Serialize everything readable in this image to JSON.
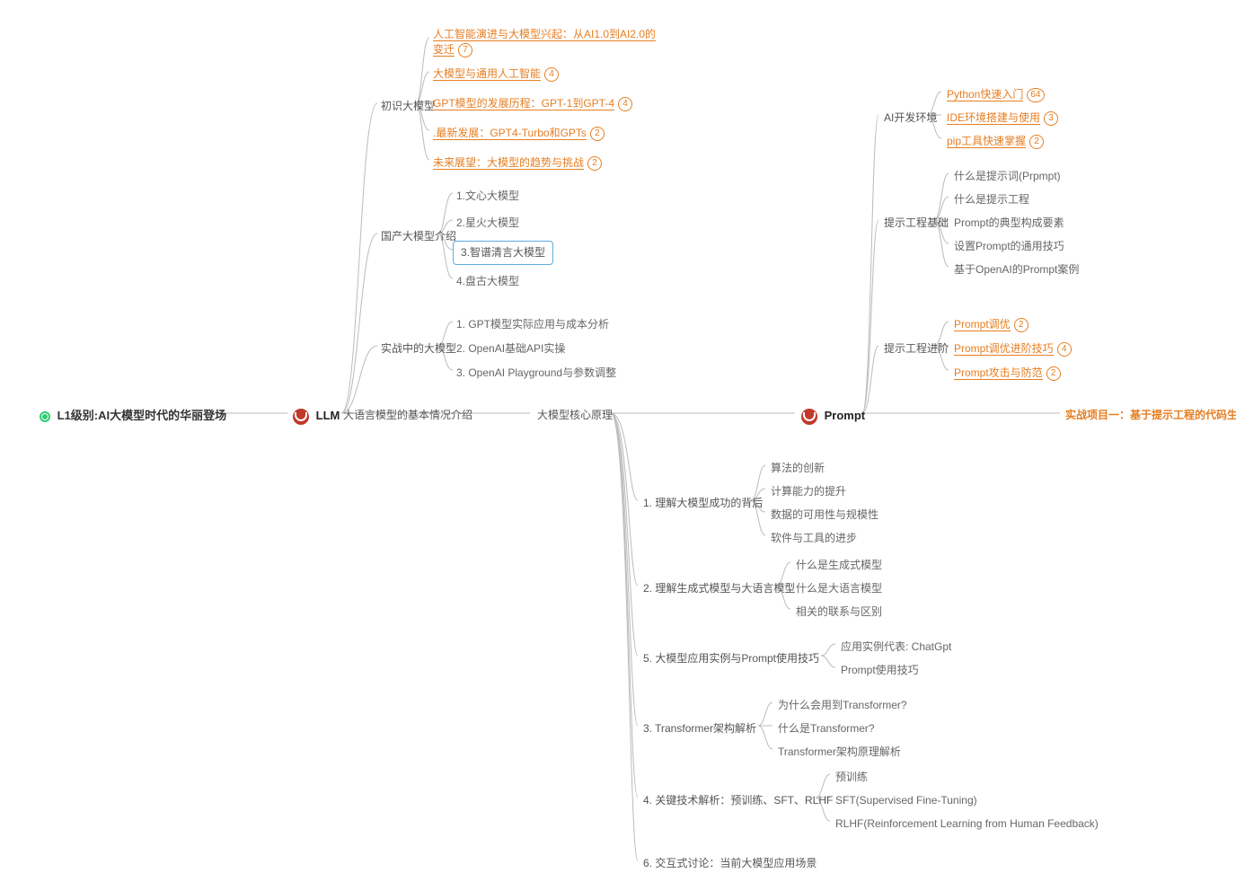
{
  "root": "L1级别:AI大模型时代的华丽登场",
  "llm": {
    "label": "LLM",
    "title": "大语言模型的基本情况介绍",
    "branch1": {
      "label": "初识大模型",
      "items": [
        {
          "text": "人工智能演进与大模型兴起：从AI1.0到AI2.0的变迁",
          "badge": "7"
        },
        {
          "text": "大模型与通用人工智能",
          "badge": "4"
        },
        {
          "text": "GPT模型的发展历程：GPT-1到GPT-4",
          "badge": "4"
        },
        {
          "text": ".最新发展：GPT4-Turbo和GPTs",
          "badge": "2"
        },
        {
          "text": "未来展望：大模型的趋势与挑战",
          "badge": "2"
        }
      ]
    },
    "branch2": {
      "label": "国产大模型介绍",
      "items": [
        {
          "text": "1.文心大模型"
        },
        {
          "text": "2.星火大模型"
        },
        {
          "text": "3.智谱清言大模型",
          "highlighted": true
        },
        {
          "text": "4.盘古大模型"
        }
      ]
    },
    "branch3": {
      "label": "实战中的大模型",
      "items": [
        {
          "text": "1. GPT模型实际应用与成本分析"
        },
        {
          "text": "2. OpenAI基础API实操"
        },
        {
          "text": "3. OpenAI Playground与参数调整"
        }
      ]
    }
  },
  "core": {
    "title": "大模型核心原理",
    "sec1": {
      "label": "1. 理解大模型成功的背后",
      "items": [
        "算法的创新",
        "计算能力的提升",
        "数据的可用性与规模性",
        "软件与工具的进步"
      ]
    },
    "sec2": {
      "label": "2. 理解生成式模型与大语言模型",
      "items": [
        "什么是生成式模型",
        "什么是大语言模型",
        "相关的联系与区别"
      ]
    },
    "sec5": {
      "label": "5. 大模型应用实例与Prompt使用技巧",
      "items": [
        "应用实例代表: ChatGpt",
        "Prompt使用技巧"
      ]
    },
    "sec3": {
      "label": "3. Transformer架构解析",
      "items": [
        "为什么会用到Transformer?",
        "什么是Transformer?",
        "Transformer架构原理解析"
      ]
    },
    "sec4": {
      "label": "4. 关键技术解析：预训练、SFT、RLHF",
      "items": [
        "预训练",
        "SFT(Supervised Fine-Tuning)",
        "RLHF(Reinforcement Learning from Human Feedback)"
      ]
    },
    "sec6": {
      "label": "6. 交互式讨论：当前大模型应用场景"
    }
  },
  "prompt": {
    "label": "Prompt",
    "env": {
      "label": "AI开发环境",
      "items": [
        {
          "text": "Python快速入门",
          "badge": "64"
        },
        {
          "text": "IDE环境搭建与使用",
          "badge": "3"
        },
        {
          "text": "pip工具快速掌握",
          "badge": "2"
        }
      ]
    },
    "basic": {
      "label": "提示工程基础",
      "items": [
        "什么是提示词(Prpmpt)",
        "什么是提示工程",
        "Prompt的典型构成要素",
        "设置Prompt的通用技巧",
        "基于OpenAI的Prompt案例"
      ]
    },
    "adv": {
      "label": "提示工程进阶",
      "items": [
        {
          "text": "Prompt调优",
          "badge": "2"
        },
        {
          "text": "Prompt调优进阶技巧",
          "badge": "4"
        },
        {
          "text": "Prompt攻击与防范",
          "badge": "2"
        }
      ]
    }
  },
  "project": "实战项目一：基于提示工程的代码生成"
}
